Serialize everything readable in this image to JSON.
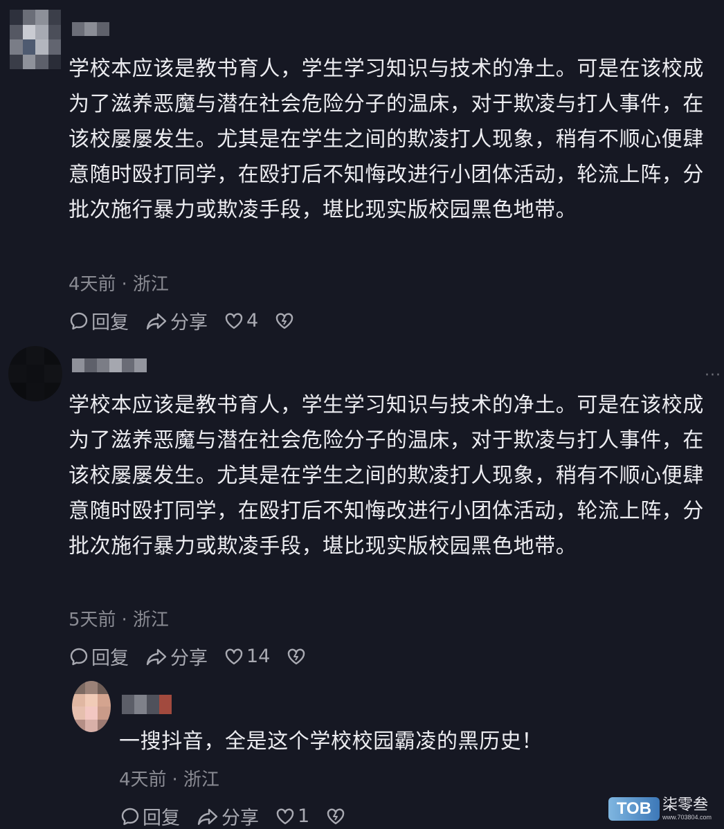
{
  "comments": [
    {
      "content": "学校本应该是教书育人，学生学习知识与技术的净土。可是在该校成为了滋养恶魔与潜在社会危险分子的温床，对于欺凌与打人事件，在该校屡屡发生。尤其是在学生之间的欺凌打人现象，稍有不顺心便肆意随时殴打同学，在殴打后不知悔改进行小团体活动，轮流上阵，分批次施行暴力或欺凌手段，堪比现实版校园黑色地带。",
      "time": "4天前",
      "location": "浙江",
      "reply_label": "回复",
      "share_label": "分享",
      "likes": "4"
    },
    {
      "content": "学校本应该是教书育人，学生学习知识与技术的净土。可是在该校成为了滋养恶魔与潜在社会危险分子的温床，对于欺凌与打人事件，在该校屡屡发生。尤其是在学生之间的欺凌打人现象，稍有不顺心便肆意随时殴打同学，在殴打后不知悔改进行小团体活动，轮流上阵，分批次施行暴力或欺凌手段，堪比现实版校园黑色地带。",
      "time": "5天前",
      "location": "浙江",
      "reply_label": "回复",
      "share_label": "分享",
      "likes": "14"
    }
  ],
  "reply": {
    "content": "一搜抖音，全是这个学校校园霸凌的黑历史！",
    "time": "4天前",
    "location": "浙江",
    "reply_label": "回复",
    "share_label": "分享",
    "likes": "1"
  },
  "separator": "·",
  "more_label": "···",
  "watermark": {
    "logo": "TOB",
    "name": "柒零叁",
    "url": "www.703804.com"
  },
  "colors": {
    "background": "#161823",
    "text": "#ececf0",
    "meta": "#8a8b93",
    "action": "#a9aab2"
  },
  "icons": [
    "comment-bubble-icon",
    "share-arrow-icon",
    "heart-icon",
    "broken-heart-icon",
    "more-options-icon"
  ]
}
